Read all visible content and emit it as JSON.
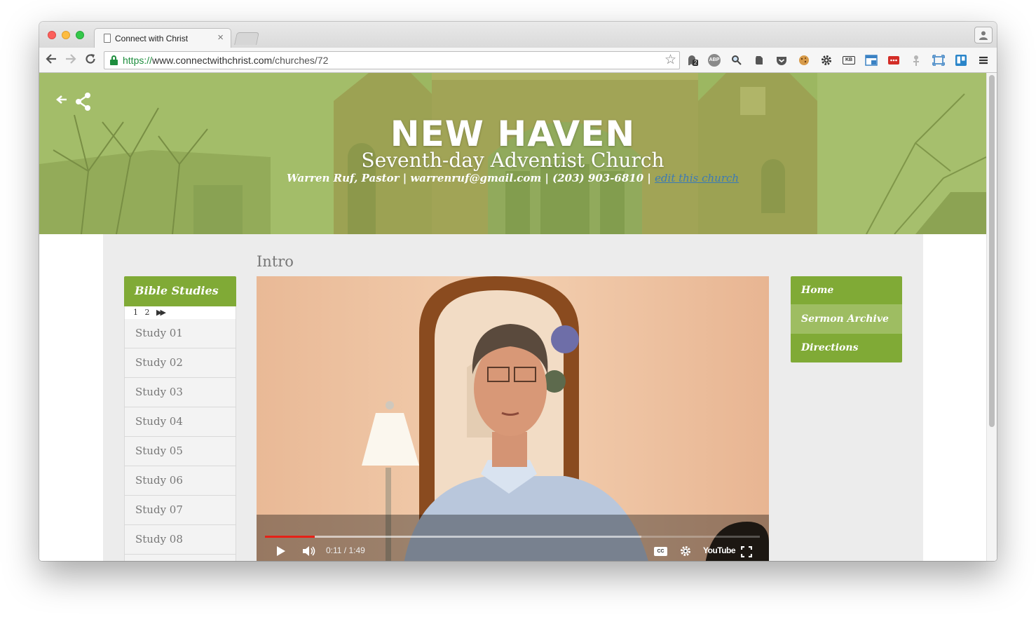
{
  "browser": {
    "tab_title": "Connect with Christ",
    "url": {
      "scheme": "https://",
      "host": "www.connectwithchrist.com",
      "path": "/churches/72"
    },
    "extensions": [
      "ghostery-icon",
      "adblock-icon",
      "lens-icon",
      "evernote-icon",
      "pocket-icon",
      "cookie-icon",
      "gear-icon",
      "kb-icon",
      "window-icon",
      "lastpass-icon",
      "pin-icon",
      "screenshot-icon",
      "trello-icon",
      "menu-icon"
    ],
    "badge_count": "2",
    "adblock_label": "ABP",
    "kb_label": "KB"
  },
  "hero": {
    "name": "NEW HAVEN",
    "subtitle": "Seventh-day Adventist Church",
    "info": "Warren Ruf, Pastor | warrenruf@gmail.com | (203) 903-6810  |",
    "edit_link": "edit this church"
  },
  "main": {
    "section_title": "Intro"
  },
  "studies": {
    "header": "Bible Studies",
    "pages": [
      "1",
      "2"
    ],
    "items": [
      "Study 01",
      "Study 02",
      "Study 03",
      "Study 04",
      "Study 05",
      "Study 06",
      "Study 07",
      "Study 08"
    ]
  },
  "nav": {
    "items": [
      "Home",
      "Sermon Archive",
      "Directions"
    ],
    "active_index": 1
  },
  "video": {
    "current_time": "0:11",
    "duration": "1:49",
    "time_display": "0:11 / 1:49",
    "progress": 0.1,
    "buffered": 0.76,
    "youtube_label": "YouTube",
    "cc_label": "CC"
  },
  "colors": {
    "accent_green": "#80aa36",
    "nav_active": "#9ebd62",
    "edit_link": "#3b7ab6",
    "progress_red": "#e62117"
  }
}
